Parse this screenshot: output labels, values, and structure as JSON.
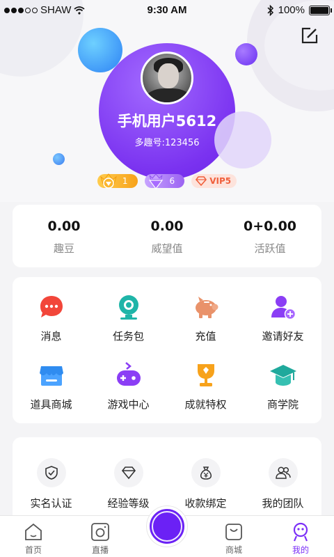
{
  "status_bar": {
    "carrier": "SHAW",
    "time": "9:30 AM",
    "battery": "100%"
  },
  "profile": {
    "username": "手机用户5612",
    "user_id": "多趣号:123456"
  },
  "badges": {
    "level": "1",
    "diamond": "6",
    "vip": "VIP5"
  },
  "stats": [
    {
      "value": "0.00",
      "label": "趣豆"
    },
    {
      "value": "0.00",
      "label": "威望值"
    },
    {
      "value": "0+0.00",
      "label": "活跃值"
    }
  ],
  "menu": [
    {
      "label": "消息",
      "icon": "message-icon"
    },
    {
      "label": "任务包",
      "icon": "task-camera-icon"
    },
    {
      "label": "充值",
      "icon": "piggy-bank-icon"
    },
    {
      "label": "邀请好友",
      "icon": "invite-friend-icon"
    },
    {
      "label": "道具商城",
      "icon": "shop-icon"
    },
    {
      "label": "游戏中心",
      "icon": "gamepad-icon"
    },
    {
      "label": "成就特权",
      "icon": "trophy-icon"
    },
    {
      "label": "商学院",
      "icon": "graduation-cap-icon"
    }
  ],
  "extra": [
    {
      "label": "实名认证",
      "icon": "shield-check-icon"
    },
    {
      "label": "经验等级",
      "icon": "diamond-outline-icon"
    },
    {
      "label": "收款绑定",
      "icon": "money-bag-icon"
    },
    {
      "label": "我的团队",
      "icon": "team-icon"
    }
  ],
  "tabs": {
    "home": "首页",
    "live": "直播",
    "mall": "商城",
    "mine": "我的"
  },
  "colors": {
    "accent": "#7b2ff7",
    "gold": "#f7a21b",
    "vip": "#f0603d"
  }
}
